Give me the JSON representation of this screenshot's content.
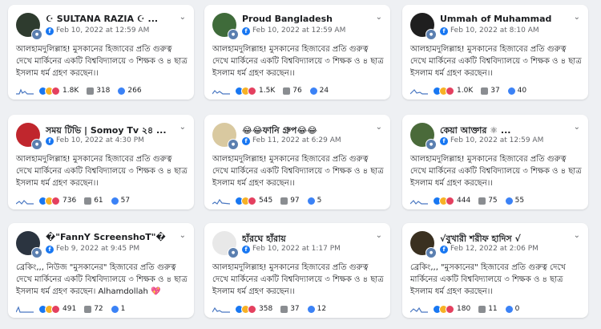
{
  "post_text": "আলহামদুলিল্লাহ! মুসকানের হিজাবের প্রতি গুরুত্ব দেখে মার্কিনের একটি বিশ্ববিদ্যালয়ে ৩ শিক্ষক ও ৪ ছাত্র ইসলাম ধর্ম গ্রহণ করছেন।।",
  "cards": [
    {
      "name": "☪ SULTANA RAZIA ☪ ...",
      "date": "Feb 10, 2022 at 12:59 AM",
      "text": "আলহামদুলিল্লাহ! মুসকানের হিজাবের প্রতি গুরুত্ব দেখে মার্কিনের একটি বিশ্ববিদ্যালয়ে ৩ শিক্ষক ও ৪ ছাত্র ইসলাম ধর্ম গ্রহণ করছেন।।",
      "reactions": "1.8K",
      "comments": "318",
      "shares": "266",
      "avatar_color": "#2e3b2e"
    },
    {
      "name": "Proud Bangladesh",
      "date": "Feb 10, 2022 at 12:59 AM",
      "text": "আলহামদুলিল্লাহ! মুসকানের হিজাবের প্রতি গুরুত্ব দেখে মার্কিনের একটি বিশ্ববিদ্যালয়ে ৩ শিক্ষক ও ৪ ছাত্র ইসলাম ধর্ম গ্রহণ করছেন।।",
      "reactions": "1.5K",
      "comments": "76",
      "shares": "24",
      "avatar_color": "#3f6b3a"
    },
    {
      "name": "Ummah of Muhammad",
      "date": "Feb 10, 2022 at 8:10 AM",
      "text": "আলহামদুলিল্লাহ! মুসকানের হিজাবের প্রতি গুরুত্ব দেখে মার্কিনের একটি বিশ্ববিদ্যালয়ে ৩ শিক্ষক ও ৪ ছাত্র ইসলাম ধর্ম গ্রহণ করছেন।।",
      "reactions": "1.0K",
      "comments": "37",
      "shares": "40",
      "avatar_color": "#1f1f1f"
    },
    {
      "name": "সময় টিভি | Somoy Tv ২৪ ...",
      "date": "Feb 10, 2022 at 4:30 PM",
      "text": "আলহামদুলিল্লাহ! মুসকানের হিজাবের প্রতি গুরুত্ব দেখে মার্কিনের একটি বিশ্ববিদ্যালয়ে ৩ শিক্ষক ও ৪ ছাত্র ইসলাম ধর্ম গ্রহণ করছেন।।",
      "reactions": "736",
      "comments": "61",
      "shares": "57",
      "avatar_color": "#c0262d"
    },
    {
      "name": "😂😂ফানি গ্রুপ😂😂",
      "date": "Feb 11, 2022 at 6:29 AM",
      "text": "আলহামদুলিল্লাহ! মুসকানের হিজাবের প্রতি গুরুত্ব দেখে মার্কিনের একটি বিশ্ববিদ্যালয়ে ৩ শিক্ষক ও ৪ ছাত্র ইসলাম ধর্ম গ্রহণ করছেন।।",
      "reactions": "545",
      "comments": "97",
      "shares": "5",
      "avatar_color": "#d9c9a0"
    },
    {
      "name": "কেয়া আক্তার ⚛ ...",
      "date": "Feb 10, 2022 at 12:59 AM",
      "text": "আলহামদুলিল্লাহ! মুসকানের হিজাবের প্রতি গুরুত্ব দেখে মার্কিনের একটি বিশ্ববিদ্যালয়ে ৩ শিক্ষক ও ৪ ছাত্র ইসলাম ধর্ম গ্রহণ করছেন।।",
      "reactions": "444",
      "comments": "75",
      "shares": "55",
      "avatar_color": "#4a6a3a"
    },
    {
      "name": "�\"FannY ScreenshoT\"�",
      "date": "Feb 9, 2022 at 9:45 PM",
      "text": "ব্রেকিং,,, নিউজ \"মুসকানের\" হিজাবের প্রতি গুরুত্ব দেখে মার্কিনের একটি বিশ্ববিদ্যালয়ে ৩ শিক্ষক ও ৪ ছাত্র ইসলাম ধর্ম গ্রহণ করছেন। Alhamdollah 💖",
      "reactions": "491",
      "comments": "72",
      "shares": "1",
      "avatar_color": "#2b3440"
    },
    {
      "name": "হাঁরঘে হাঁরায়",
      "date": "Feb 10, 2022 at 1:17 PM",
      "text": "আলহামদুলিল্লাহ! মুসকানের হিজাবের প্রতি গুরুত্ব দেখে মার্কিনের একটি বিশ্ববিদ্যালয়ে ৩ শিক্ষক ও ৪ ছাত্র ইসলাম ধর্ম গ্রহণ করছেন।।",
      "reactions": "358",
      "comments": "37",
      "shares": "12",
      "avatar_color": "#e8e8e8"
    },
    {
      "name": "√বুখারী শরীফ হাদিস √",
      "date": "Feb 12, 2022 at 2:06 PM",
      "text": "ব্রেকিং,,, \"মুসকানের\" হিজাবের প্রতি গুরুত্ব দেখে মার্কিনের একটি বিশ্ববিদ্যালয়ে ৩ শিক্ষক ও ৪ ছাত্র ইসলাম ধর্ম গ্রহণ করছেন।।",
      "reactions": "180",
      "comments": "11",
      "shares": "0",
      "avatar_color": "#3a3020"
    }
  ],
  "icons": {
    "menu": "chevron-down-icon",
    "globe": "globe-icon",
    "comment": "comment-icon",
    "share": "share-icon"
  },
  "colors": {
    "like": "#1877f2",
    "haha": "#f7b125",
    "love": "#e4405f",
    "background": "#eef0f3"
  }
}
